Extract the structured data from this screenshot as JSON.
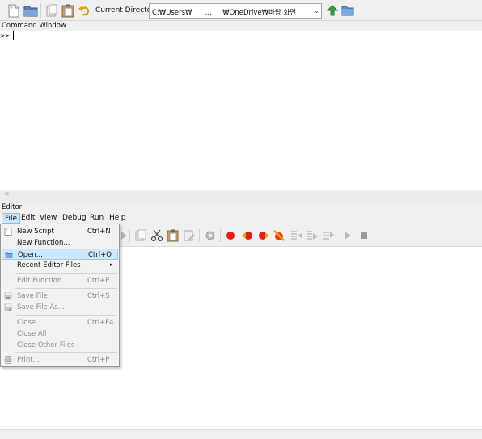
{
  "toolbar": {
    "icons": [
      "new-file-icon",
      "open-folder-icon",
      "cut-icon",
      "paste-icon",
      "undo-icon"
    ],
    "current_directory_label": "Current Directory:",
    "current_directory_value": "C:₩Users₩      ...     ₩OneDrive₩바탕 화면",
    "up_icon": "arrow-up-icon",
    "browse_icon": "folder-icon"
  },
  "command_window": {
    "title": "Command Window",
    "prompt": ">>"
  },
  "splitter_arrow": "<",
  "editor": {
    "title": "Editor"
  },
  "menubar": {
    "items": [
      "File",
      "Edit",
      "View",
      "Debug",
      "Run",
      "Help"
    ],
    "active": "File"
  },
  "file_menu": {
    "items": [
      {
        "label": "New Script",
        "accel": "Ctrl+N",
        "icon": "new-script-icon",
        "enabled": true
      },
      {
        "label": "New Function...",
        "accel": "",
        "icon": "",
        "enabled": true
      },
      {
        "label": "Open...",
        "accel": "Ctrl+O",
        "icon": "open-folder-icon",
        "enabled": true,
        "highlighted": true
      },
      {
        "label": "Recent Editor Files",
        "accel": "",
        "icon": "",
        "enabled": true,
        "submenu": true
      },
      {
        "label": "Edit Function",
        "accel": "Ctrl+E",
        "icon": "",
        "enabled": false
      },
      {
        "label": "Save File",
        "accel": "Ctrl+S",
        "icon": "save-icon",
        "enabled": false
      },
      {
        "label": "Save File As...",
        "accel": "",
        "icon": "save-as-icon",
        "enabled": false
      },
      {
        "label": "Close",
        "accel": "Ctrl+F4",
        "icon": "",
        "enabled": false
      },
      {
        "label": "Close All",
        "accel": "",
        "icon": "",
        "enabled": false
      },
      {
        "label": "Close Other Files",
        "accel": "",
        "icon": "",
        "enabled": false
      },
      {
        "label": "Print...",
        "accel": "Ctrl+P",
        "icon": "print-icon",
        "enabled": false
      }
    ],
    "submenu_arrow": "▸"
  },
  "colors": {
    "menu_highlight": "#cce8ff",
    "breakpoint_red": "#e02020",
    "run_gray": "#9a9a9a"
  }
}
